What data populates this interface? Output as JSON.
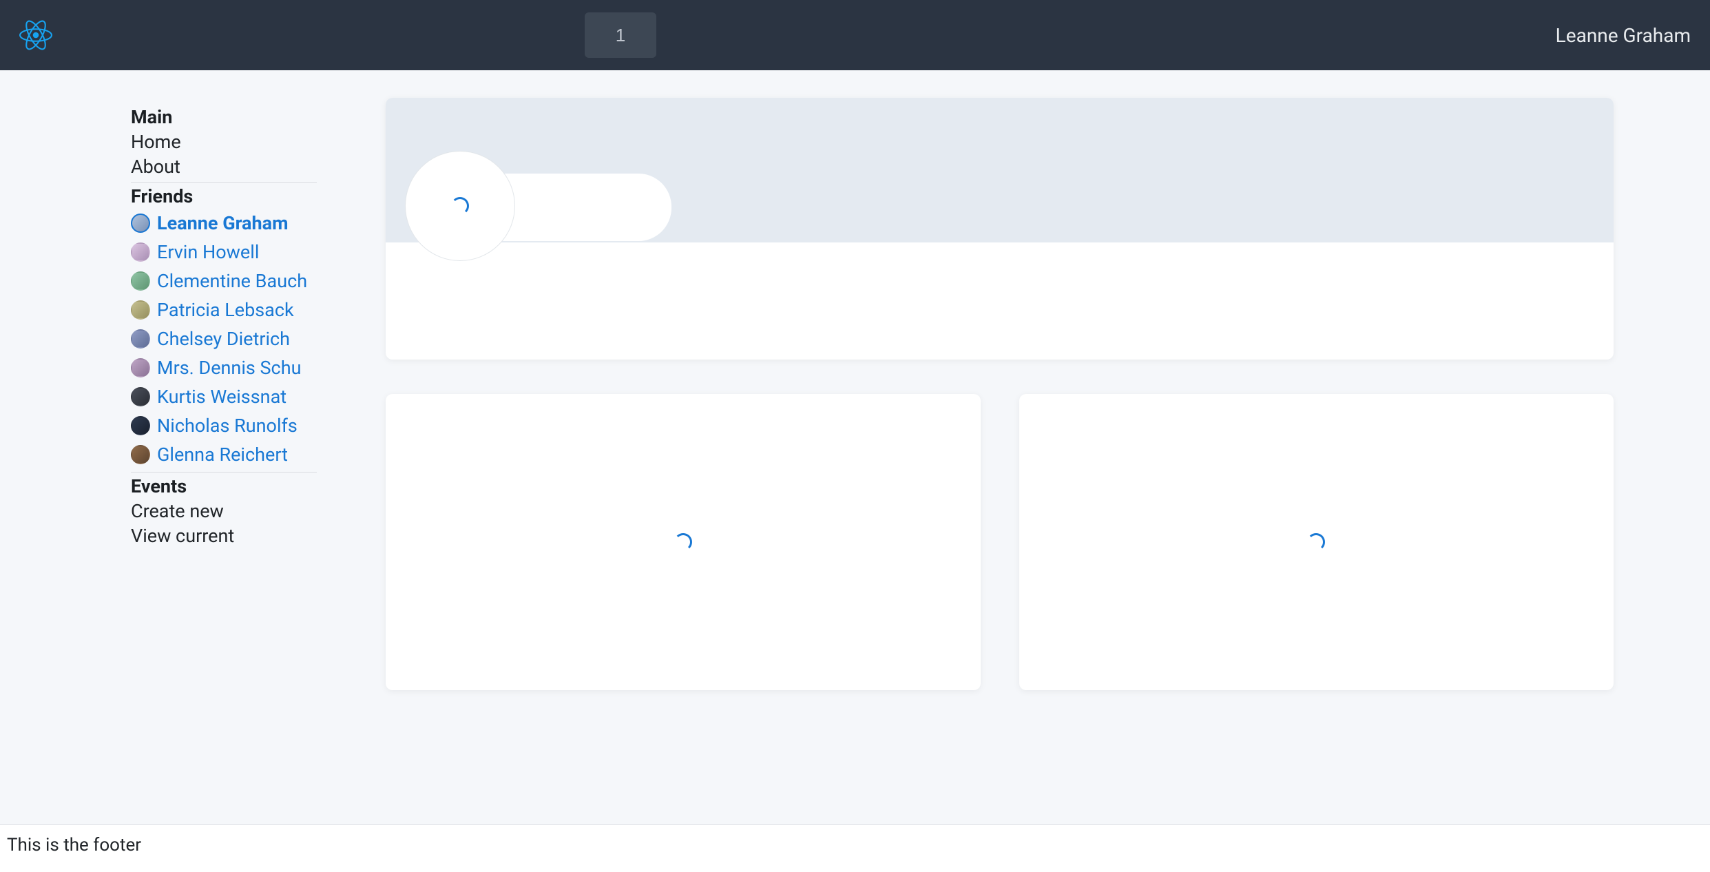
{
  "header": {
    "search_value": "1",
    "user_name": "Leanne Graham"
  },
  "sidebar": {
    "main": {
      "heading": "Main",
      "home": "Home",
      "about": "About"
    },
    "friends": {
      "heading": "Friends",
      "items": [
        {
          "name": "Leanne Graham",
          "selected": true
        },
        {
          "name": "Ervin Howell",
          "selected": false
        },
        {
          "name": "Clementine Bauch",
          "selected": false
        },
        {
          "name": "Patricia Lebsack",
          "selected": false
        },
        {
          "name": "Chelsey Dietrich",
          "selected": false
        },
        {
          "name": "Mrs. Dennis Schu",
          "selected": false
        },
        {
          "name": "Kurtis Weissnat",
          "selected": false
        },
        {
          "name": "Nicholas Runolfs",
          "selected": false
        },
        {
          "name": "Glenna Reichert",
          "selected": false
        }
      ]
    },
    "events": {
      "heading": "Events",
      "create": "Create new",
      "view": "View current"
    }
  },
  "footer": {
    "text": "This is the footer"
  },
  "colors": {
    "header_bg": "#2b3442",
    "link": "#1978d4",
    "page_bg": "#f5f7fa"
  }
}
